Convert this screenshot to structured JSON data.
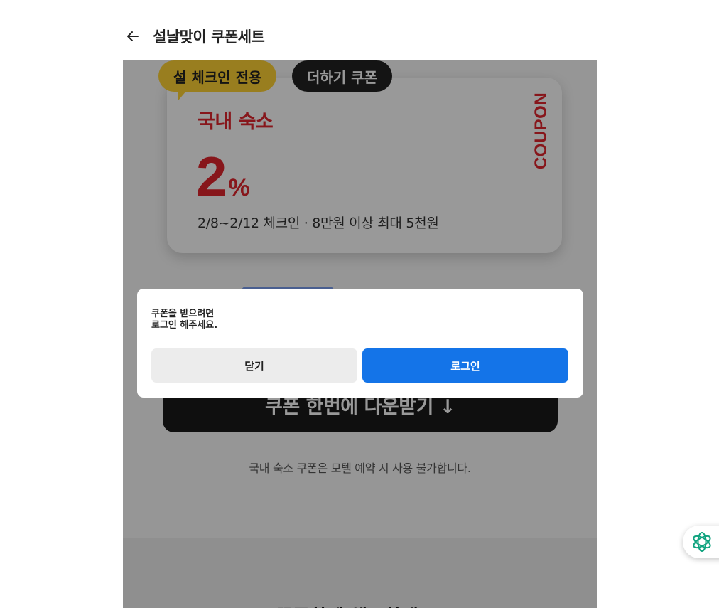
{
  "header": {
    "back_icon": "arrow-left-icon",
    "title": "설날맞이 쿠폰세트"
  },
  "coupon_card": {
    "tag_primary": "설 체크인 전용",
    "tag_secondary": "더하기 쿠폰",
    "category": "국내 숙소",
    "discount_value": "2",
    "discount_unit": "%",
    "description": "2/8~2/12 체크인 · 8만원 이상 최대 5천원",
    "vertical_label": "COUPON",
    "accent_color": "#e1262d",
    "tag_primary_color": "#ffd335",
    "tag_secondary_color": "#222222"
  },
  "download_button": {
    "label": "쿠폰 한번에 다운받기 ↓"
  },
  "notice": "국내 숙소 쿠폰은 모텔 예약 시 사용 불가합니다.",
  "bottom_heading": "꼼꼼하게 체크하세요!",
  "modal": {
    "message": "쿠폰을 받으려면\n로그인 해주세요.",
    "close_label": "닫기",
    "login_label": "로그인",
    "login_color": "#1474e8"
  },
  "floating_button": {
    "icon": "ai-assistant-icon"
  }
}
